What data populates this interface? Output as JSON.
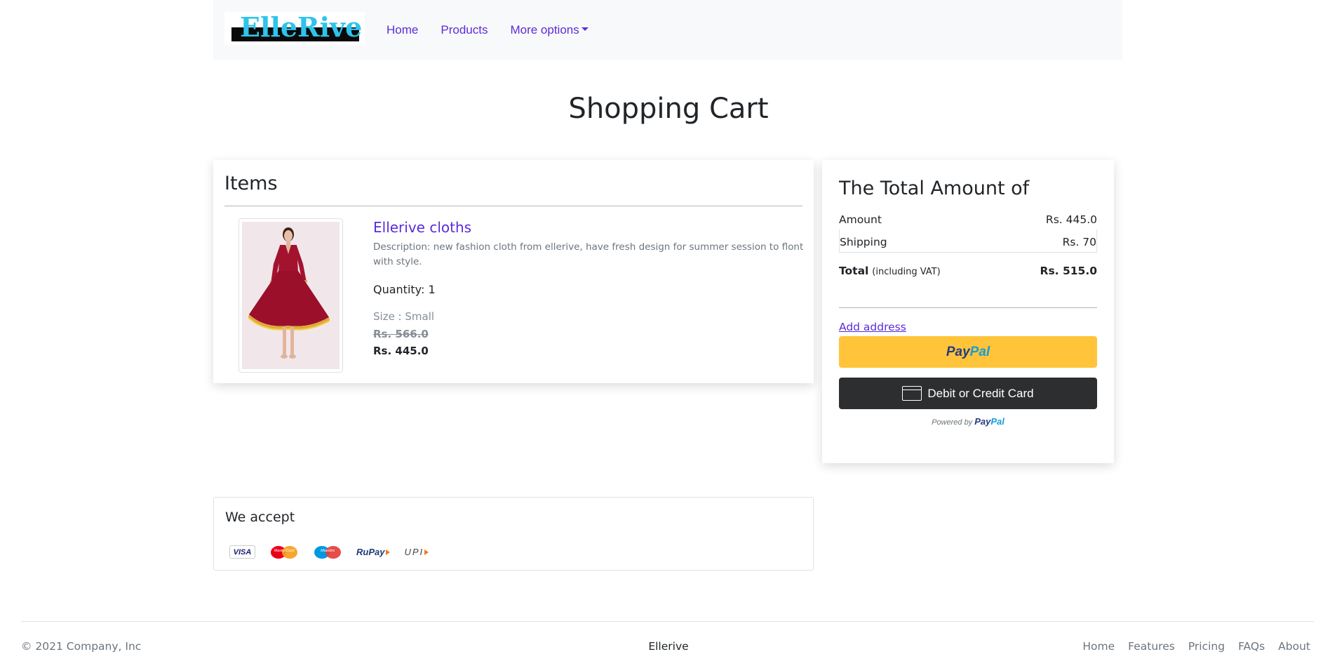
{
  "navbar": {
    "logo_text": "ElleRive",
    "links": [
      "Home",
      "Products"
    ],
    "dropdown_label": "More options"
  },
  "page": {
    "title": "Shopping Cart"
  },
  "items": {
    "heading": "Items",
    "product": {
      "name": "Ellerive cloths",
      "description": "Description: new fashion cloth from ellerive, have fresh design for summer session to flont with style.",
      "quantity": "Quantity: 1",
      "size": "Size : Small",
      "original_price": "Rs. 566.0",
      "price": "Rs. 445.0"
    }
  },
  "summary": {
    "heading": "The Total Amount of",
    "amount_label": "Amount",
    "amount_value": "Rs. 445.0",
    "shipping_label": "Shipping",
    "shipping_value": "Rs. 70",
    "total_label": "Total",
    "total_note": "(including VAT)",
    "total_value": "Rs. 515.0",
    "add_address": "Add address",
    "paypal_pay": "Pay",
    "paypal_pal": "Pal",
    "card_button": "Debit or Credit Card",
    "powered_by": "Powered by"
  },
  "accept": {
    "heading": "We accept",
    "methods": [
      {
        "name": "VISA",
        "icon": "visa-icon"
      },
      {
        "name": "MasterCard",
        "icon": "mastercard-icon"
      },
      {
        "name": "Maestro",
        "icon": "maestro-icon"
      },
      {
        "name": "RuPay",
        "icon": "rupay-icon"
      },
      {
        "name": "UPI",
        "icon": "upi-icon"
      }
    ]
  },
  "footer": {
    "copyright": "© 2021 Company, Inc",
    "brand": "Ellerive",
    "links": [
      "Home",
      "Features",
      "Pricing",
      "FAQs",
      "About"
    ]
  },
  "colors": {
    "accent": "#5b2bd9",
    "logo": "#2ec4ec",
    "paypal_yellow": "#ffc439",
    "card_button": "#2c2e2f",
    "dress": "#a3122f"
  }
}
